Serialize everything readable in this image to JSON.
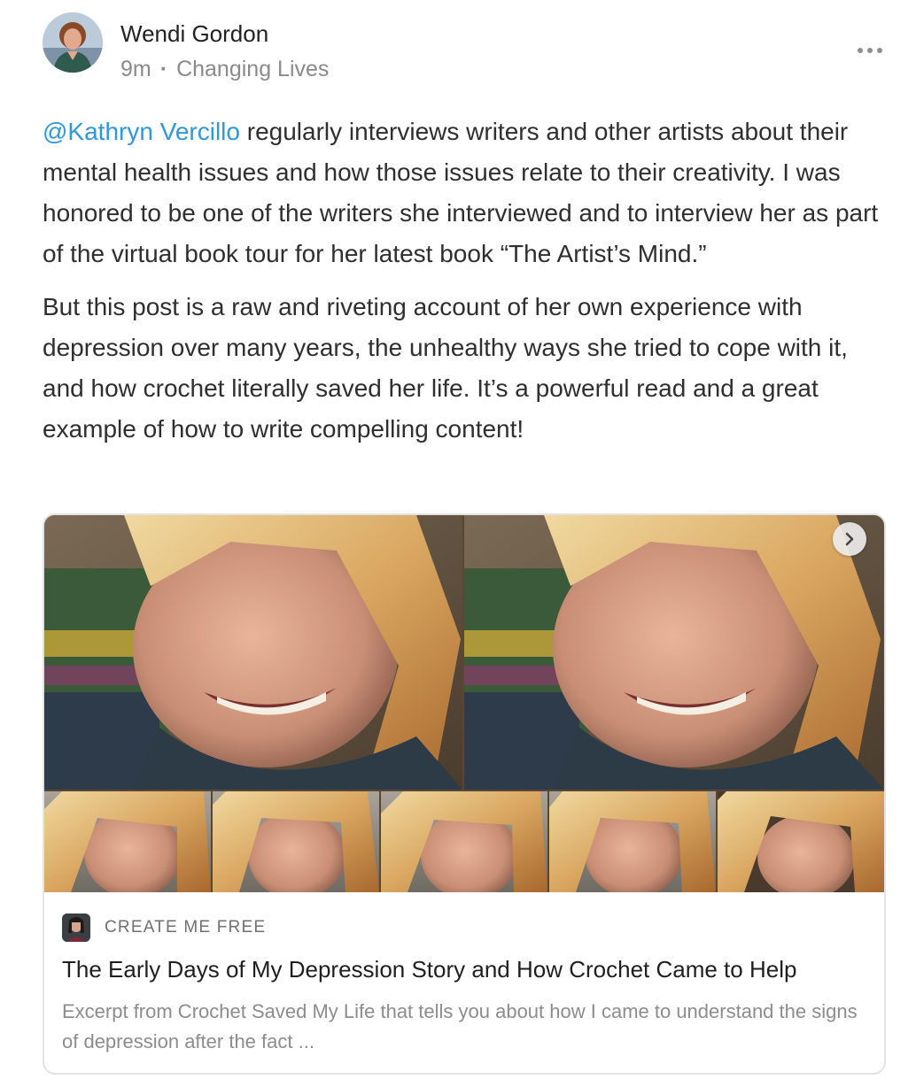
{
  "post": {
    "author": "Wendi Gordon",
    "time": "9m",
    "separator": "·",
    "category": "Changing Lives",
    "mention": "@Kathryn Vercillo",
    "paragraph1_rest": " regularly interviews writers and other artists about their mental health issues and how those issues relate to their creativity. I was honored to be one of the writers she interviewed and to interview her as part of the virtual book tour for her latest book “The Artist’s Mind.”",
    "paragraph2": "But this post is a raw and riveting account of her own experience with depression over many years, the unhealthy ways she tried to cope with it, and how crochet literally saved her life. It’s a powerful read and a great example of how to write compelling content!"
  },
  "icons": {
    "more": "more-horizontal-icon",
    "next": "chevron-right-icon"
  },
  "card": {
    "publication": "CREATE ME FREE",
    "title": "The Early Days of My Depression Story and How Crochet Came to Help",
    "excerpt": "Excerpt from Crochet Saved My Life that tells you about how I came to understand the signs of depression after the fact ..."
  },
  "colors": {
    "mention": "#2e97de",
    "meta": "#8a8a8a",
    "text": "#2f2f2f"
  }
}
